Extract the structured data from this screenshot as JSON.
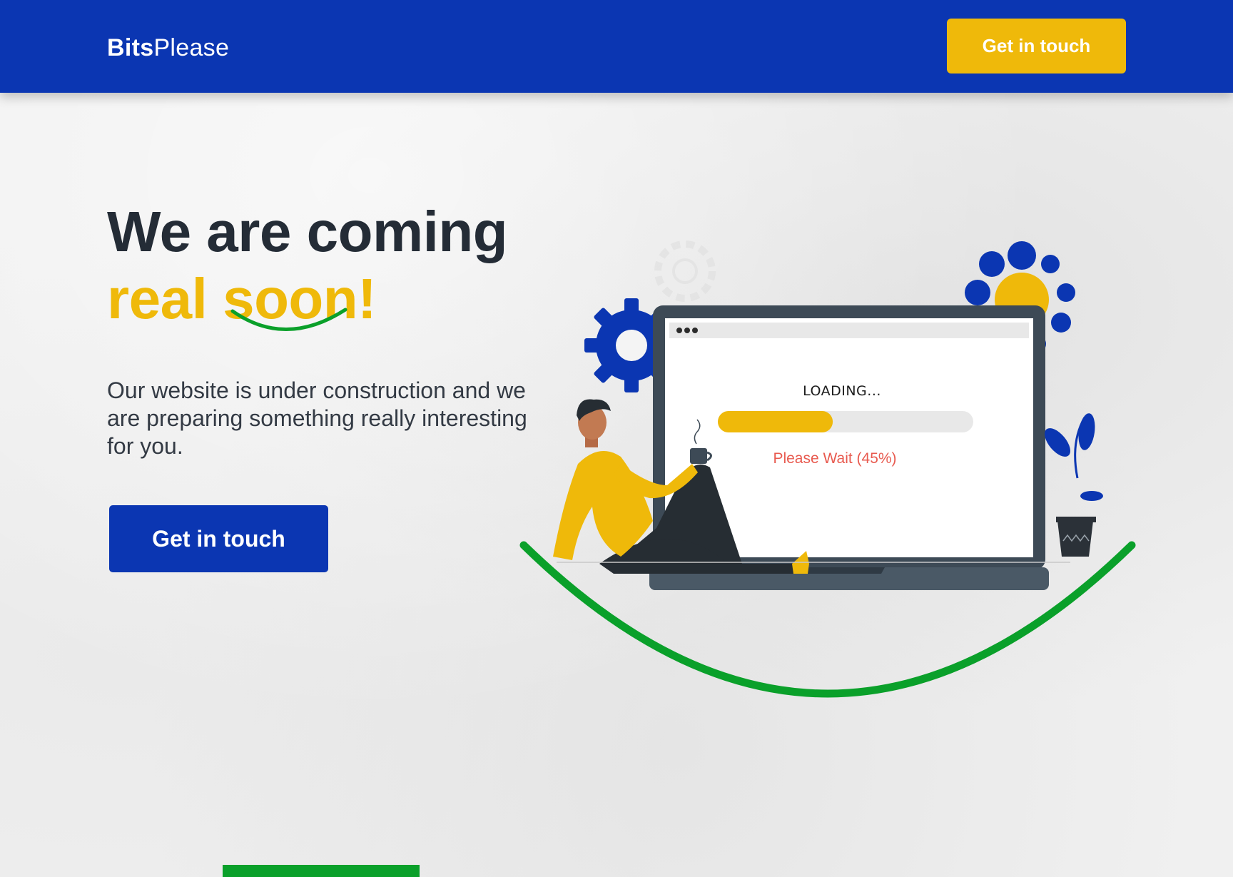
{
  "header": {
    "logo_bold": "Bits",
    "logo_light": "Please",
    "cta_label": "Get in touch"
  },
  "hero": {
    "title_line1": "We are coming",
    "title_line2": "real soon!",
    "subtitle": "Our website is under construction and we are preparing something really interesting for you.",
    "cta_label": "Get in touch"
  },
  "loading_screen": {
    "label": "LOADING...",
    "progress_percent": 45,
    "wait_text": "Please Wait (45%)"
  },
  "colors": {
    "brand_blue": "#0b36b2",
    "accent_yellow": "#efb90a",
    "accent_green": "#0aa02a",
    "wait_text_red": "#e85a4f",
    "dark_text": "#242c36"
  },
  "icons": [
    "gear-icon",
    "flower-icon",
    "laptop-icon",
    "coffee-cup-icon",
    "plant-icon",
    "person-illustration"
  ]
}
